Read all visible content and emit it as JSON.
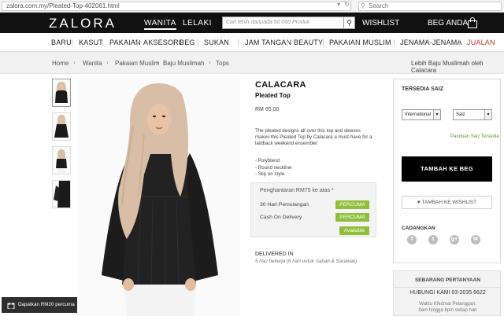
{
  "browser": {
    "url": "zalora.com.my/Pleated-Top-402061.html",
    "search_placeholder": "Search"
  },
  "topnav": {
    "logo": "ZALORA",
    "gender_active": "WANITA",
    "gender_other": "LELAKI",
    "search_placeholder": "Cari lebih daripada 50 000 Produk",
    "wishlist": "WISHLIST",
    "account": "BEG ANDA"
  },
  "categories": [
    "BARU",
    "KASUT",
    "PAKAIAN",
    "AKSESORI",
    "BEG",
    "SUKAN",
    "JAM TANGAN",
    "BEAUTY",
    "PAKAIAN MUSLIM",
    "JENAMA-JENAMA",
    "JUALAN"
  ],
  "breadcrumb": [
    "Home",
    "Wanita",
    "Pakaian Muslim",
    "Baju Muslimah",
    "Tops"
  ],
  "more_by": "Lebih Baju Muslimah oleh Calacara",
  "product": {
    "brand": "CALACARA",
    "name": "Pleated Top",
    "price": "RM 65.00",
    "description": "The pleated designs all over this top and sleeves makes this Pleated Top by Calacara a must-have for a laidback weekend ensemble!",
    "features": [
      "- Polyblend",
      "- Round neckline",
      "- Slip on style"
    ]
  },
  "shipping": {
    "title": "Penghantaran RM75 ke atas *",
    "rows": [
      {
        "label": "30 Hari Pemulangan",
        "badge": "PERCUMA"
      },
      {
        "label": "Cash On Delivery",
        "badge": "PERCUMA"
      },
      {
        "label": "",
        "badge": "Available"
      }
    ]
  },
  "delivery": {
    "title": "DELIVERED IN",
    "text": "5 hari bekerja (6 hari untuk Sabah & Sarawak)."
  },
  "size_panel": {
    "title": "TERSEDIA SAIZ",
    "system_value": "International",
    "size_value": "Saiz",
    "size_guide": "Panduan Saiz Tersedia",
    "add_to_bag": "TAMBAH KE BEG",
    "add_to_wishlist": "TAMBAH KE WISHLIST",
    "share_title": "CADANGKAN",
    "social": [
      {
        "icon": "facebook-icon",
        "glyph": "f"
      },
      {
        "icon": "twitter-icon",
        "glyph": "t"
      },
      {
        "icon": "google-plus-icon",
        "glyph": "g+"
      },
      {
        "icon": "email-icon",
        "glyph": "✉"
      }
    ]
  },
  "contact": {
    "title": "SEBARANG PERTANYAAN",
    "phone": "HUBUNGI KAMI 03-2035 6622",
    "hours_1": "Waktu Khidmat Pelanggan:",
    "hours_2": "9am hingga 6pm setiap hari"
  },
  "promo": {
    "text": "Dapatkan RM20 percuma"
  },
  "colors": {
    "nav_bg": "#111111",
    "badge_green": "#8fbf3a",
    "sale_red": "#c0392b",
    "guide_green": "#5c9a2d"
  }
}
